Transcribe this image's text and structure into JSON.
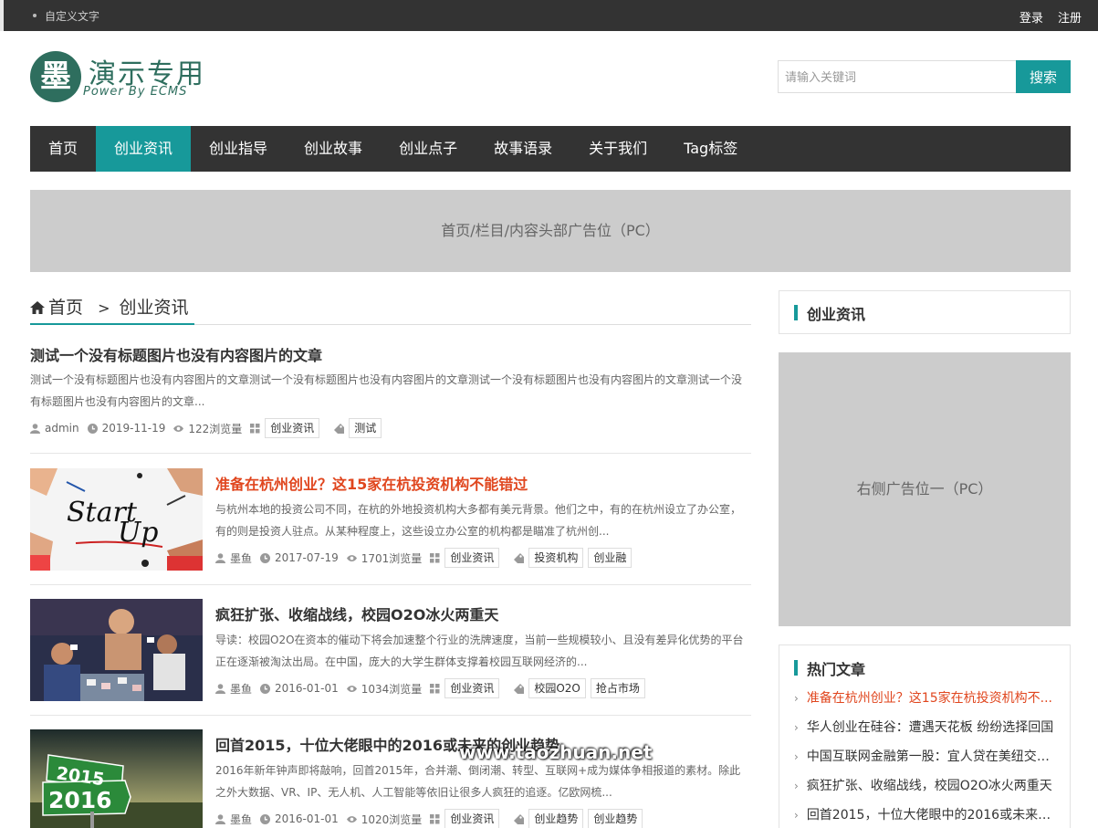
{
  "topbar": {
    "custom_text": "自定义文字",
    "login": "登录",
    "register": "注册"
  },
  "logo": {
    "glyph": "墨",
    "title": "演示专用",
    "subtitle": "Power By ECMS"
  },
  "search": {
    "placeholder": "请输入关键词",
    "button": "搜索"
  },
  "nav": [
    "首页",
    "创业资讯",
    "创业指导",
    "创业故事",
    "创业点子",
    "故事语录",
    "关于我们",
    "Tag标签"
  ],
  "ad_top": "首页/栏目/内容头部广告位（PC）",
  "breadcrumb": {
    "home": "首页",
    "sep": ">",
    "current": "创业资讯"
  },
  "articles": [
    {
      "title": "测试一个没有标题图片也没有内容图片的文章",
      "summary": "测试一个没有标题图片也没有内容图片的文章测试一个没有标题图片也没有内容图片的文章测试一个没有标题图片也没有内容图片的文章测试一个没有标题图片也没有内容图片的文章...",
      "author": "admin",
      "date": "2019-11-19",
      "views": "122浏览量",
      "category": "创业资讯",
      "tags": [
        "测试"
      ]
    },
    {
      "title": "准备在杭州创业？这15家在杭投资机构不能错过",
      "summary": "与杭州本地的投资公司不同，在杭的外地投资机构大多都有美元背景。他们之中，有的在杭州设立了办公室，有的则是投资人驻点。从某种程度上，这些设立办公室的机构都是瞄准了杭州创...",
      "author": "墨鱼",
      "date": "2017-07-19",
      "views": "1701浏览量",
      "category": "创业资讯",
      "tags": [
        "投资机构",
        "创业融"
      ],
      "thumb_text": [
        "Start",
        "Up"
      ]
    },
    {
      "title": "疯狂扩张、收缩战线，校园O2O冰火两重天",
      "summary": "导读：校园O2O在资本的催动下将会加速整个行业的洗牌速度，当前一些规模较小、且没有差异化优势的平台正在逐渐被淘汰出局。在中国，庞大的大学生群体支撑着校园互联网经济的...",
      "author": "墨鱼",
      "date": "2016-01-01",
      "views": "1034浏览量",
      "category": "创业资讯",
      "tags": [
        "校园O2O",
        "抢占市场"
      ]
    },
    {
      "title": "回首2015，十位大佬眼中的2016或未来的创业趋势",
      "summary": "2016年新年钟声即将敲响，回首2015年，合并潮、倒闭潮、转型、互联网+成为媒体争相报道的素材。除此之外大数据、VR、IP、无人机、人工智能等依旧让很多人疯狂的追逐。亿欧网梳...",
      "author": "墨鱼",
      "date": "2016-01-01",
      "views": "1020浏览量",
      "category": "创业资讯",
      "tags": [
        "创业趋势",
        "创业趋势"
      ],
      "thumb_text": [
        "2015",
        "2016"
      ]
    }
  ],
  "sidebar": {
    "title": "创业资讯",
    "ad": "右侧广告位一（PC）",
    "hot_title": "热门文章",
    "hot": [
      "准备在杭州创业？这15家在杭投资机构不...",
      "华人创业在硅谷：遭遇天花板 纷纷选择回国",
      "中国互联网金融第一股：宜人贷在美纽交所...",
      "疯狂扩张、收缩战线，校园O2O冰火两重天",
      "回首2015，十位大佬眼中的2016或未来的..."
    ]
  },
  "watermark": "www.taozhuan.net",
  "colors": {
    "accent": "#17999a",
    "dark": "#333333",
    "highlight": "#e0461e",
    "logo": "#2e6e5e"
  }
}
